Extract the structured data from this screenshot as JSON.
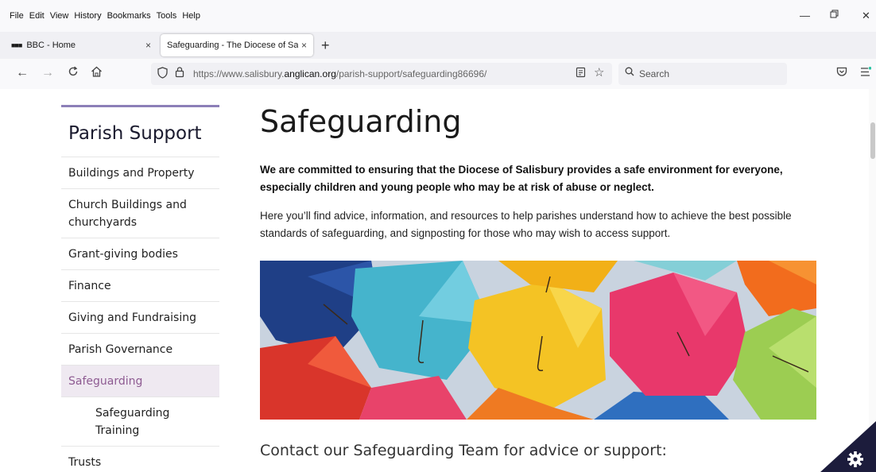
{
  "menu": {
    "items": [
      "File",
      "Edit",
      "View",
      "History",
      "Bookmarks",
      "Tools",
      "Help"
    ]
  },
  "window_controls": {
    "minimize": "—",
    "restore": "🗗",
    "close": "✕"
  },
  "tabs": [
    {
      "favicon": "■■■",
      "title": "BBC - Home",
      "close": "×"
    },
    {
      "title": "Safeguarding - The Diocese of Salisbury",
      "close": "×"
    }
  ],
  "new_tab": "+",
  "nav": {
    "back": "←",
    "forward": "→",
    "reload": "C",
    "home": "⌂",
    "url_prefix": "https://www.salisbury.",
    "url_domain": "anglican.org",
    "url_path": "/parish-support/safeguarding86696/",
    "search_placeholder": "Search"
  },
  "sidebar": {
    "title": "Parish Support",
    "items": [
      {
        "label": "Buildings and Property"
      },
      {
        "label": "Church Buildings and churchyards"
      },
      {
        "label": "Grant-giving bodies"
      },
      {
        "label": "Finance"
      },
      {
        "label": "Giving and Fundraising"
      },
      {
        "label": "Parish Governance"
      },
      {
        "label": "Safeguarding"
      },
      {
        "label": "Safeguarding Training"
      },
      {
        "label": "Trusts"
      }
    ]
  },
  "main": {
    "title": "Safeguarding",
    "lead": "We are committed to ensuring that the Diocese of Salisbury provides a safe environment for everyone, especially children and young people who may be at risk of abuse or neglect.",
    "body": "Here you’ll find advice, information, and resources to help parishes understand how to achieve the best possible standards of safeguarding, and signposting for those who may wish to access support.",
    "contact_heading": "Contact our Safeguarding Team for advice or support:"
  },
  "colors": {
    "accent_purple": "#8c7fb8",
    "active_item_bg": "#efe9f1",
    "active_item_text": "#8e5b92",
    "corner_badge": "#1c1c3c"
  }
}
